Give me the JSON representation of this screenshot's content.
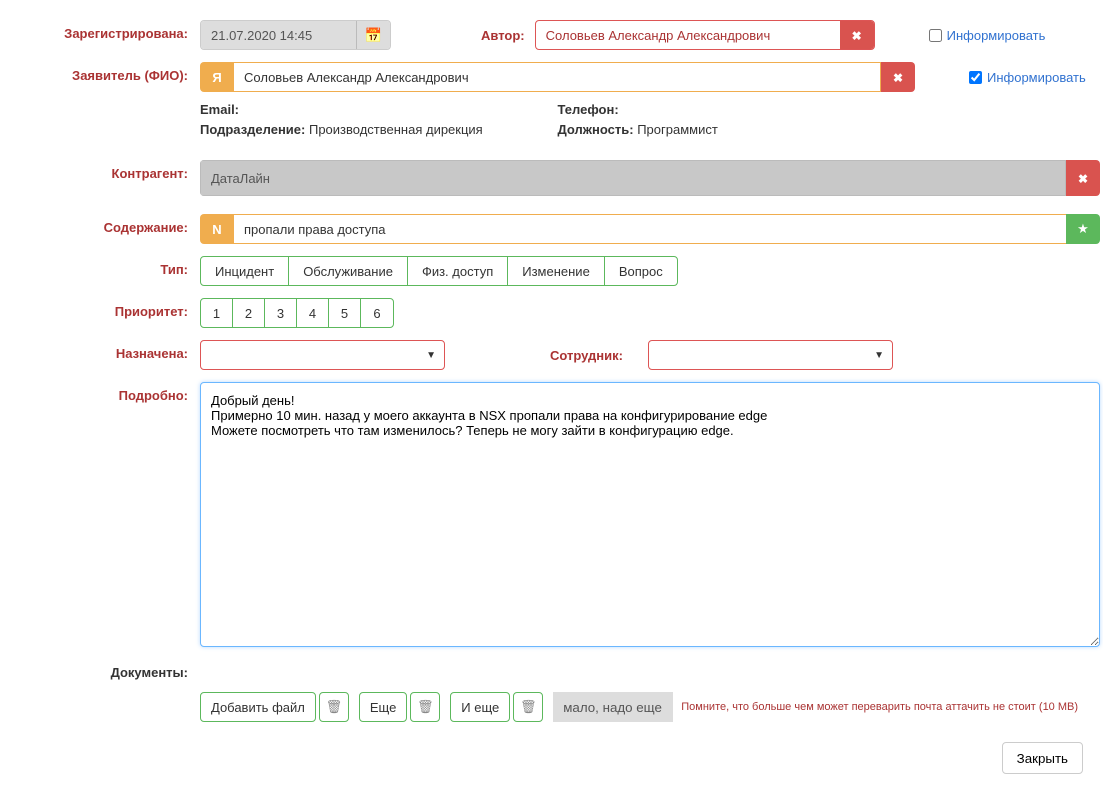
{
  "labels": {
    "registered": "Зарегистрирована:",
    "author": "Автор:",
    "applicant": "Заявитель (ФИО):",
    "email": "Email:",
    "phone": "Телефон:",
    "department": "Подразделение:",
    "position": "Должность:",
    "counterparty": "Контрагент:",
    "subject": "Содержание:",
    "type": "Тип:",
    "priority": "Приоритет:",
    "assigned": "Назначена:",
    "employee": "Сотрудник:",
    "details": "Подробно:",
    "documents": "Документы:",
    "inform": "Информировать"
  },
  "values": {
    "registered_date": "21.07.2020 14:45",
    "author_name": "Соловьев Александр Александрович",
    "applicant_name": "Соловьев Александр Александрович",
    "email": "",
    "phone": "",
    "department": "Производственная дирекция",
    "position": "Программист",
    "counterparty": "ДатаЛайн",
    "subject_text": "пропали права доступа",
    "details_text": "Добрый день!\nПримерно 10 мин. назад у моего аккаунта в NSX пропали права на конфигурирование edge\nМожете посмотреть что там изменилось? Теперь не могу зайти в конфигурацию edge."
  },
  "applicant_badge": "Я",
  "subject_badge": "N",
  "type_options": [
    "Инцидент",
    "Обслуживание",
    "Физ. доступ",
    "Изменение",
    "Вопрос"
  ],
  "priority_options": [
    "1",
    "2",
    "3",
    "4",
    "5",
    "6"
  ],
  "documents": {
    "add_file": "Добавить файл",
    "more": "Еще",
    "and_more": "И еще",
    "need_more": "мало, надо еще...",
    "note": "Помните, что больше чем может переварить почта аттачить не стоит (10 MB)"
  },
  "close_btn": "Закрыть",
  "inform_author_checked": false,
  "inform_applicant_checked": true
}
